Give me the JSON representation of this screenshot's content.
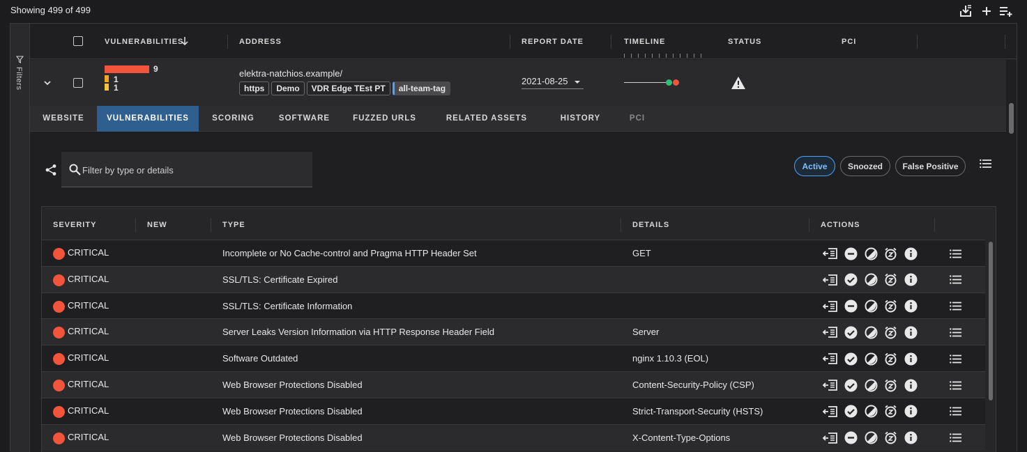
{
  "header": {
    "showing": "Showing 499 of 499",
    "icons": [
      "download-list-icon",
      "plus-icon",
      "add-list-icon"
    ]
  },
  "filters": {
    "label": "Filters",
    "icon": "funnel-icon"
  },
  "columns": {
    "vulnerabilities": "VULNERABILITIES",
    "address": "ADDRESS",
    "report_date": "REPORT DATE",
    "timeline": "TIMELINE",
    "status": "STATUS",
    "pci": "PCI"
  },
  "asset": {
    "counts": {
      "critical": "9",
      "medium": "1",
      "low": "1"
    },
    "colors": {
      "critical": "#f2553c",
      "medium": "#f5a623",
      "low": "#f5c242"
    },
    "address": "elektra-natchios.example/",
    "tags": [
      "https",
      "Demo",
      "VDR Edge TEst PT",
      "all-team-tag"
    ],
    "report_date": "2021-08-25",
    "status_icon": "warning-icon"
  },
  "tabs": [
    {
      "label": "WEBSITE"
    },
    {
      "label": "VULNERABILITIES",
      "active": true
    },
    {
      "label": "SCORING"
    },
    {
      "label": "SOFTWARE"
    },
    {
      "label": "FUZZED URLS"
    },
    {
      "label": "RELATED ASSETS"
    },
    {
      "label": "HISTORY"
    },
    {
      "label": "PCI",
      "disabled": true
    }
  ],
  "search": {
    "placeholder": "Filter by type or details"
  },
  "toggles": {
    "active": "Active",
    "snoozed": "Snoozed",
    "false_positive": "False Positive"
  },
  "vuln_columns": {
    "severity": "SEVERITY",
    "new": "NEW",
    "type": "TYPE",
    "details": "DETAILS",
    "actions": "ACTIONS"
  },
  "vulns": [
    {
      "severity": "CRITICAL",
      "type": "Incomplete or No Cache-control and Pragma HTTP Header Set",
      "details": "GET",
      "second_action": "minus"
    },
    {
      "severity": "CRITICAL",
      "type": "SSL/TLS: Certificate Expired",
      "details": "",
      "second_action": "check"
    },
    {
      "severity": "CRITICAL",
      "type": "SSL/TLS: Certificate Information",
      "details": "",
      "second_action": "minus"
    },
    {
      "severity": "CRITICAL",
      "type": "Server Leaks Version Information via HTTP Response Header Field",
      "details": "Server",
      "second_action": "check"
    },
    {
      "severity": "CRITICAL",
      "type": "Software Outdated",
      "details": "nginx 1.10.3 (EOL)",
      "second_action": "check"
    },
    {
      "severity": "CRITICAL",
      "type": "Web Browser Protections Disabled",
      "details": "Content-Security-Policy (CSP)",
      "second_action": "check"
    },
    {
      "severity": "CRITICAL",
      "type": "Web Browser Protections Disabled",
      "details": "Strict-Transport-Security (HSTS)",
      "second_action": "check"
    },
    {
      "severity": "CRITICAL",
      "type": "Web Browser Protections Disabled",
      "details": "X-Content-Type-Options",
      "second_action": "minus"
    }
  ]
}
